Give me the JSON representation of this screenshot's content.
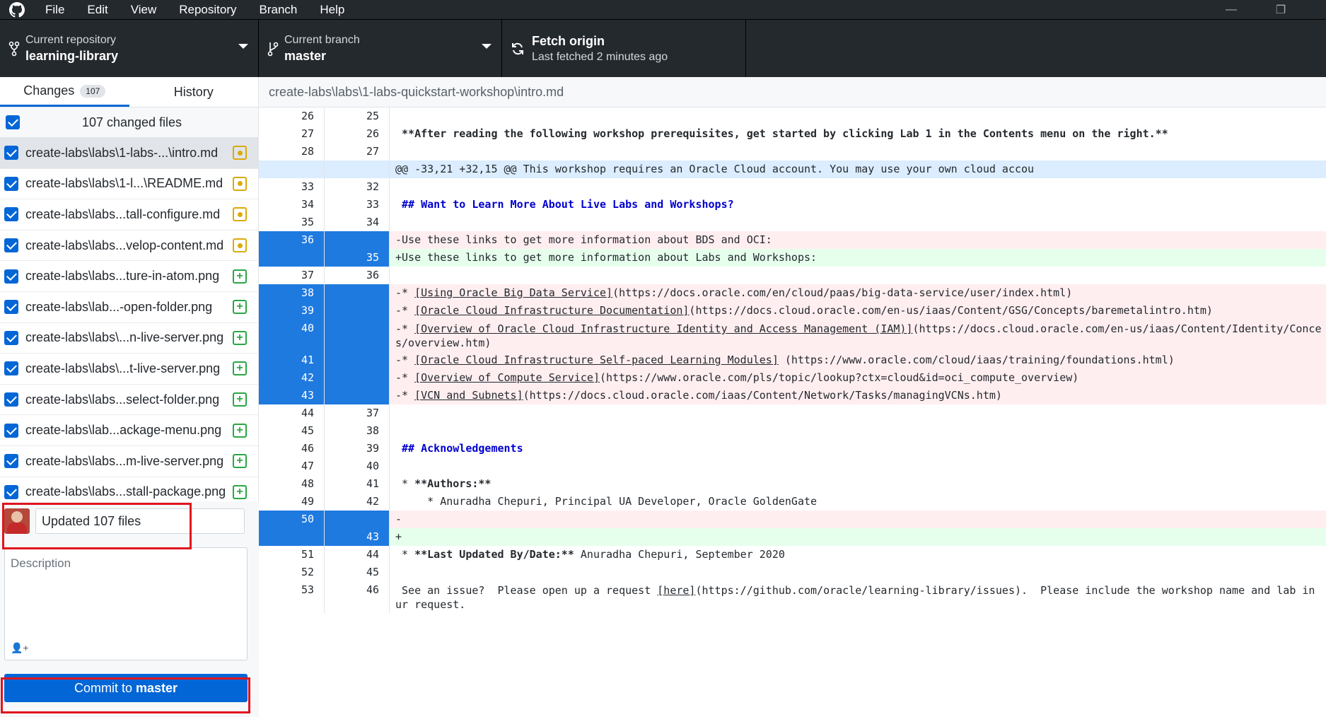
{
  "menu": {
    "items": [
      "File",
      "Edit",
      "View",
      "Repository",
      "Branch",
      "Help"
    ]
  },
  "toolbar": {
    "repo_label": "Current repository",
    "repo_value": "learning-library",
    "branch_label": "Current branch",
    "branch_value": "master",
    "fetch_label": "Fetch origin",
    "fetch_sub": "Last fetched 2 minutes ago"
  },
  "sidebar": {
    "tab_changes": "Changes",
    "tab_changes_count": "107",
    "tab_history": "History",
    "changed_header": "107 changed files",
    "files": [
      {
        "name": "create-labs\\labs\\1-labs-...\\intro.md",
        "status": "modified"
      },
      {
        "name": "create-labs\\labs\\1-l...\\README.md",
        "status": "modified"
      },
      {
        "name": "create-labs\\labs...tall-configure.md",
        "status": "modified"
      },
      {
        "name": "create-labs\\labs...velop-content.md",
        "status": "modified"
      },
      {
        "name": "create-labs\\labs...ture-in-atom.png",
        "status": "added"
      },
      {
        "name": "create-labs\\lab...-open-folder.png",
        "status": "added"
      },
      {
        "name": "create-labs\\labs\\...n-live-server.png",
        "status": "added"
      },
      {
        "name": "create-labs\\labs\\...t-live-server.png",
        "status": "added"
      },
      {
        "name": "create-labs\\labs...select-folder.png",
        "status": "added"
      },
      {
        "name": "create-labs\\lab...ackage-menu.png",
        "status": "added"
      },
      {
        "name": "create-labs\\labs...m-live-server.png",
        "status": "added"
      },
      {
        "name": "create-labs\\labs...stall-package.png",
        "status": "added"
      }
    ],
    "summary_value": "Updated 107 files",
    "description_placeholder": "Description",
    "commit_label": "Commit to",
    "commit_branch": "master"
  },
  "diff": {
    "path": "create-labs\\labs\\1-labs-quickstart-workshop\\intro.md",
    "lines": [
      {
        "old": "26",
        "new": "25",
        "type": "ctx",
        "text": ""
      },
      {
        "old": "27",
        "new": "26",
        "type": "ctx",
        "text": " **After reading the following workshop prerequisites, get started by clicking Lab 1 in the Contents menu on the right.**",
        "style": "bold"
      },
      {
        "old": "28",
        "new": "27",
        "type": "ctx",
        "text": ""
      },
      {
        "old": "",
        "new": "",
        "type": "hunk",
        "text": "@@ -33,21 +32,15 @@ This workshop requires an Oracle Cloud account. You may use your own cloud accou"
      },
      {
        "old": "33",
        "new": "32",
        "type": "ctx",
        "text": ""
      },
      {
        "old": "34",
        "new": "33",
        "type": "ctx",
        "text": " ## Want to Learn More About Live Labs and Workshops?",
        "style": "head"
      },
      {
        "old": "35",
        "new": "34",
        "type": "ctx",
        "text": ""
      },
      {
        "old": "36",
        "new": "",
        "type": "del",
        "text": "-Use these links to get more information about BDS and OCI:"
      },
      {
        "old": "",
        "new": "35",
        "type": "add",
        "text": "+Use these links to get more information about Labs and Workshops:"
      },
      {
        "old": "37",
        "new": "36",
        "type": "ctx",
        "text": ""
      },
      {
        "old": "38",
        "new": "",
        "type": "del",
        "text": "-* ",
        "link": "[Using Oracle Big Data Service]",
        "rest": "(https://docs.oracle.com/en/cloud/paas/big-data-service/user/index.html)"
      },
      {
        "old": "39",
        "new": "",
        "type": "del",
        "text": "-* ",
        "link": "[Oracle Cloud Infrastructure Documentation]",
        "rest": "(https://docs.cloud.oracle.com/en-us/iaas/Content/GSG/Concepts/baremetalintro.htm)"
      },
      {
        "old": "40",
        "new": "",
        "type": "del",
        "text": "-* ",
        "link": "[Overview of Oracle Cloud Infrastructure Identity and Access Management (IAM)]",
        "rest": "(https://docs.cloud.oracle.com/en-us/iaas/Content/Identity/Conce",
        "wrap": "s/overview.htm)"
      },
      {
        "old": "41",
        "new": "",
        "type": "del",
        "text": "-* ",
        "link": "[Oracle Cloud Infrastructure Self-paced Learning Modules]",
        "rest": " (https://www.oracle.com/cloud/iaas/training/foundations.html)"
      },
      {
        "old": "42",
        "new": "",
        "type": "del",
        "text": "-* ",
        "link": "[Overview of Compute Service]",
        "rest": "(https://www.oracle.com/pls/topic/lookup?ctx=cloud&id=oci_compute_overview)"
      },
      {
        "old": "43",
        "new": "",
        "type": "del",
        "text": "-* ",
        "link": "[VCN and Subnets]",
        "rest": "(https://docs.cloud.oracle.com/iaas/Content/Network/Tasks/managingVCNs.htm)"
      },
      {
        "old": "44",
        "new": "37",
        "type": "ctx",
        "text": ""
      },
      {
        "old": "45",
        "new": "38",
        "type": "ctx",
        "text": ""
      },
      {
        "old": "46",
        "new": "39",
        "type": "ctx",
        "text": " ## Acknowledgements",
        "style": "head"
      },
      {
        "old": "47",
        "new": "40",
        "type": "ctx",
        "text": ""
      },
      {
        "old": "48",
        "new": "41",
        "type": "ctx",
        "text": " * ",
        "bold": "**Authors:**"
      },
      {
        "old": "49",
        "new": "42",
        "type": "ctx",
        "text": "     * Anuradha Chepuri, Principal UA Developer, Oracle GoldenGate"
      },
      {
        "old": "50",
        "new": "",
        "type": "del",
        "text": "-"
      },
      {
        "old": "",
        "new": "43",
        "type": "add",
        "text": "+"
      },
      {
        "old": "51",
        "new": "44",
        "type": "ctx",
        "text": " * ",
        "bold": "**Last Updated By/Date:**",
        "rest": " Anuradha Chepuri, September 2020"
      },
      {
        "old": "52",
        "new": "45",
        "type": "ctx",
        "text": ""
      },
      {
        "old": "53",
        "new": "46",
        "type": "ctx",
        "text": " See an issue?  Please open up a request ",
        "link": "[here]",
        "rest": "(https://github.com/oracle/learning-library/issues).  Please include the workshop name and lab in",
        "wrap": "ur request."
      }
    ]
  }
}
